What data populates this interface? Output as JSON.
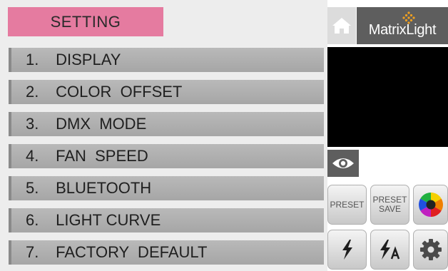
{
  "header": {
    "title": "SETTING"
  },
  "menu": {
    "items": [
      {
        "num": "1.",
        "label": "DISPLAY"
      },
      {
        "num": "2.",
        "label": "COLOR  OFFSET"
      },
      {
        "num": "3.",
        "label": "DMX  MODE"
      },
      {
        "num": "4.",
        "label": "FAN  SPEED"
      },
      {
        "num": "5.",
        "label": "BLUETOOTH"
      },
      {
        "num": "6.",
        "label": "LIGHT CURVE"
      },
      {
        "num": "7.",
        "label": "FACTORY  DEFAULT"
      }
    ]
  },
  "brand": {
    "name": "MatrixLight"
  },
  "buttons": {
    "preset": "PRESET",
    "preset_save_line1": "PRESET",
    "preset_save_line2": "SAVE"
  },
  "icons": {
    "home": "home-icon",
    "eye": "eye-icon",
    "color_wheel": "color-wheel-icon",
    "lightning": "lightning-icon",
    "lightning_auto": "lightning-auto-icon",
    "gear": "gear-icon"
  },
  "colors": {
    "title_bg": "#e57ba0",
    "menu_bg": "#b0b0b0",
    "logo_bg": "#5e5e5e",
    "logo_accent": "#f0a020"
  }
}
